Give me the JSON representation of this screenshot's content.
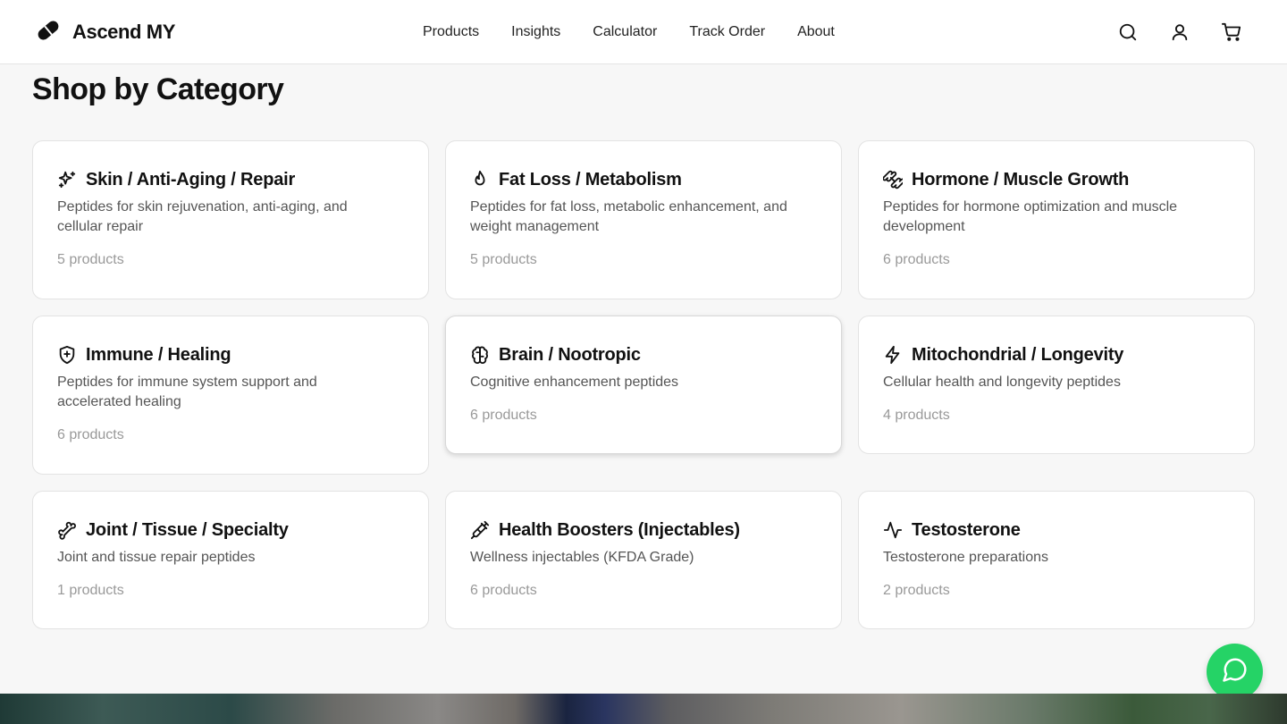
{
  "brand": {
    "name": "Ascend MY",
    "logo_icon": "pill-icon"
  },
  "nav": {
    "items": [
      {
        "label": "Products"
      },
      {
        "label": "Insights"
      },
      {
        "label": "Calculator"
      },
      {
        "label": "Track Order"
      },
      {
        "label": "About"
      }
    ]
  },
  "header_icons": [
    "search-icon",
    "user-icon",
    "cart-icon"
  ],
  "section": {
    "title": "Shop by Category"
  },
  "categories": [
    {
      "icon": "sparkles-icon",
      "title": "Skin / Anti-Aging / Repair",
      "description": "Peptides for skin rejuvenation, anti-aging, and cellular repair",
      "count": "5 products"
    },
    {
      "icon": "flame-icon",
      "title": "Fat Loss / Metabolism",
      "description": "Peptides for fat loss, metabolic enhancement, and weight management",
      "count": "5 products"
    },
    {
      "icon": "dumbbell-icon",
      "title": "Hormone / Muscle Growth",
      "description": "Peptides for hormone optimization and muscle development",
      "count": "6 products"
    },
    {
      "icon": "shield-plus-icon",
      "title": "Immune / Healing",
      "description": "Peptides for immune system support and accelerated healing",
      "count": "6 products"
    },
    {
      "icon": "brain-icon",
      "title": "Brain / Nootropic",
      "description": "Cognitive enhancement peptides",
      "count": "6 products"
    },
    {
      "icon": "zap-icon",
      "title": "Mitochondrial / Longevity",
      "description": "Cellular health and longevity peptides",
      "count": "4 products"
    },
    {
      "icon": "bone-icon",
      "title": "Joint / Tissue / Specialty",
      "description": "Joint and tissue repair peptides",
      "count": "1 products"
    },
    {
      "icon": "syringe-icon",
      "title": "Health Boosters (Injectables)",
      "description": "Wellness injectables (KFDA Grade)",
      "count": "6 products"
    },
    {
      "icon": "activity-icon",
      "title": "Testosterone",
      "description": "Testosterone preparations",
      "count": "2 products"
    }
  ],
  "chat": {
    "icon": "message-circle-icon",
    "color": "#25d366"
  }
}
